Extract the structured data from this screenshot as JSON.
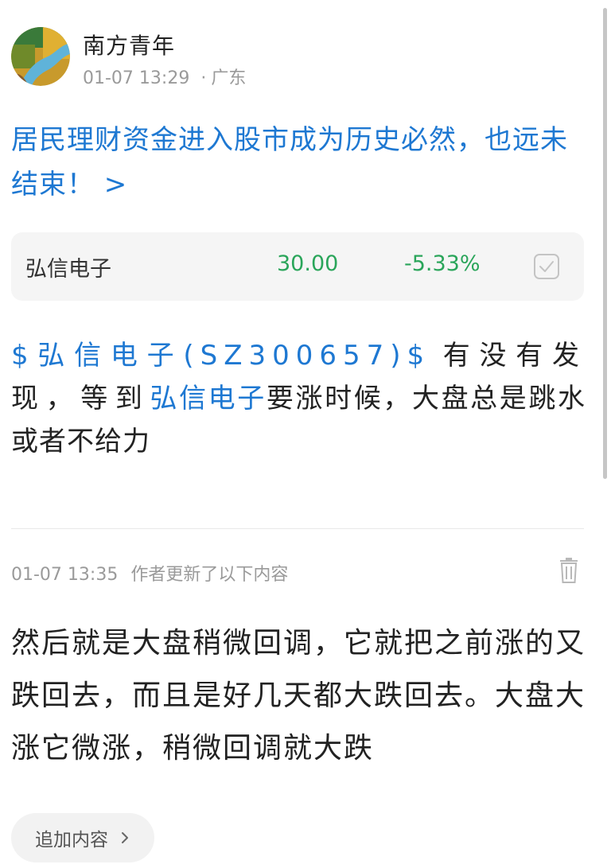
{
  "post": {
    "author": "南方青年",
    "time": "01-07 13:29",
    "separator": "·",
    "location": "广东",
    "title": "居民理财资金进入股市成为历史必然，也远未结束！ >",
    "body": {
      "stock_tag": "$弘信电子(SZ300657)$",
      "text_1": "有没有发现，等到",
      "stock_link": "弘信电子",
      "text_2": "要涨时候，大盘总是跳水或者不给力"
    }
  },
  "stock_card": {
    "name": "弘信电子",
    "price": "30.00",
    "change": "-5.33%",
    "change_color": "#2aa55a"
  },
  "update": {
    "time": "01-07 13:35",
    "label": "作者更新了以下内容",
    "text": "然后就是大盘稍微回调，它就把之前涨的又跌回去，而且是好几天都大跌回去。大盘大涨它微涨，稍微回调就大跌"
  },
  "actions": {
    "add_content": "追加内容"
  },
  "colors": {
    "link": "#1e78d2",
    "muted": "#9a9a9a",
    "down_green": "#2aa55a"
  },
  "icons": {
    "avatar": "avatar-landscape",
    "stock_check": "checkbox-icon",
    "trash": "trash-icon",
    "chevron": "chevron-right-icon"
  }
}
